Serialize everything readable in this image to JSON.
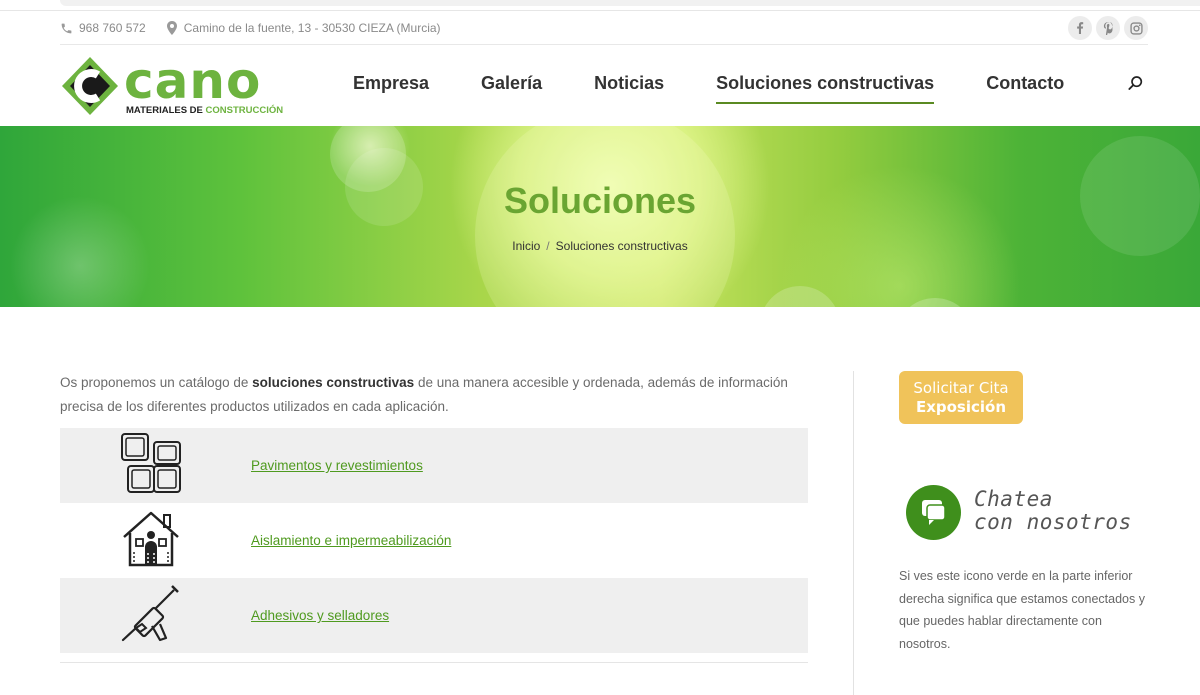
{
  "topbar": {
    "phone": "968 760 572",
    "address": "Camino de la fuente, 13 - 30530 CIEZA (Murcia)",
    "social": [
      "facebook-icon",
      "pinterest-icon",
      "instagram-icon"
    ]
  },
  "logo": {
    "word": "cano",
    "sub_dark": "MATERIALES DE ",
    "sub_green": "CONSTRUCCIÓN"
  },
  "nav": {
    "items": [
      {
        "label": "Empresa"
      },
      {
        "label": "Galería"
      },
      {
        "label": "Noticias"
      },
      {
        "label": "Soluciones constructivas",
        "active": true
      },
      {
        "label": "Contacto"
      }
    ],
    "search_icon": "search-icon"
  },
  "hero": {
    "title": "Soluciones",
    "breadcrumb_home": "Inicio",
    "breadcrumb_sep": "/",
    "breadcrumb_current": "Soluciones constructivas"
  },
  "intro": {
    "before": "Os proponemos un catálogo de ",
    "bold": "soluciones constructivas",
    "after": " de una manera accesible y ordenada, además de información precisa de los diferentes productos utilizados en cada aplicación."
  },
  "solutions": [
    {
      "label": "Pavimentos y revestimientos",
      "icon": "tiles-icon"
    },
    {
      "label": "Aislamiento e impermeabilización",
      "icon": "house-insulation-icon"
    },
    {
      "label": "Adhesivos y selladores",
      "icon": "caulking-gun-icon"
    }
  ],
  "sidebar": {
    "cita_line1": "Solicitar Cita",
    "cita_line2": "Exposición",
    "chat_line1": "Chatea",
    "chat_line2": "con nosotros",
    "chat_text": "Si ves este icono verde en la parte inferior derecha significa que estamos conectados y que puedes hablar directamente con nosotros."
  },
  "colors": {
    "brand_green": "#6db33f",
    "link_green": "#4f9a1f",
    "cta_yellow": "#f0c35a",
    "chat_green": "#3f8f1c"
  }
}
